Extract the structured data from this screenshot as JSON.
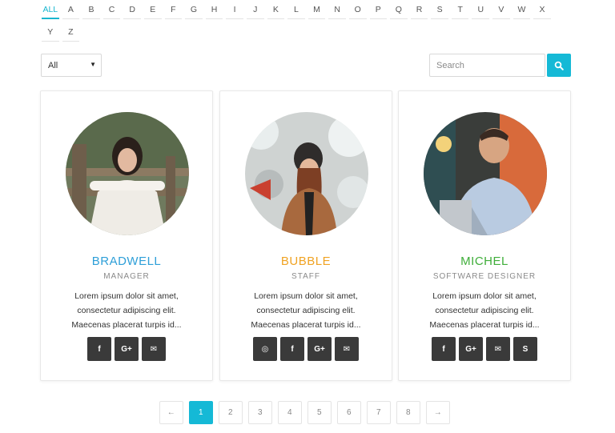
{
  "alphabet": {
    "row1": [
      "ALL",
      "A",
      "B",
      "C",
      "D",
      "E",
      "F",
      "G",
      "H",
      "I",
      "J",
      "K",
      "L",
      "M",
      "N",
      "O",
      "P",
      "Q",
      "R",
      "S",
      "T",
      "U",
      "V",
      "W",
      "X"
    ],
    "row2": [
      "Y",
      "Z"
    ],
    "active": "ALL",
    "accent": "#19b6cf"
  },
  "filter": {
    "selected": "All"
  },
  "search": {
    "placeholder": "Search",
    "value": "",
    "button_color": "#15b9d6"
  },
  "members": [
    {
      "name": "BRADWELL",
      "role": "MANAGER",
      "name_color": "#2e9fd8",
      "bio": "Lorem ipsum dolor sit amet, consectetur adipiscing elit. Maecenas placerat turpis id...",
      "socials": [
        "facebook-icon",
        "google-plus-icon",
        "email-icon"
      ]
    },
    {
      "name": "BUBBLE",
      "role": "STAFF",
      "name_color": "#f0a323",
      "bio": "Lorem ipsum dolor sit amet, consectetur adipiscing elit. Maecenas placerat turpis id...",
      "socials": [
        "dribbble-icon",
        "facebook-icon",
        "google-plus-icon",
        "email-icon"
      ]
    },
    {
      "name": "MICHEL",
      "role": "SOFTWARE DESIGNER",
      "name_color": "#3fae3a",
      "bio": "Lorem ipsum dolor sit amet, consectetur adipiscing elit. Maecenas placerat turpis id...",
      "socials": [
        "facebook-icon",
        "google-plus-icon",
        "email-icon",
        "skype-icon"
      ]
    }
  ],
  "pagination": {
    "prev": "←",
    "pages": [
      "1",
      "2",
      "3",
      "4",
      "5",
      "6",
      "7",
      "8"
    ],
    "next": "→",
    "current": "1"
  }
}
